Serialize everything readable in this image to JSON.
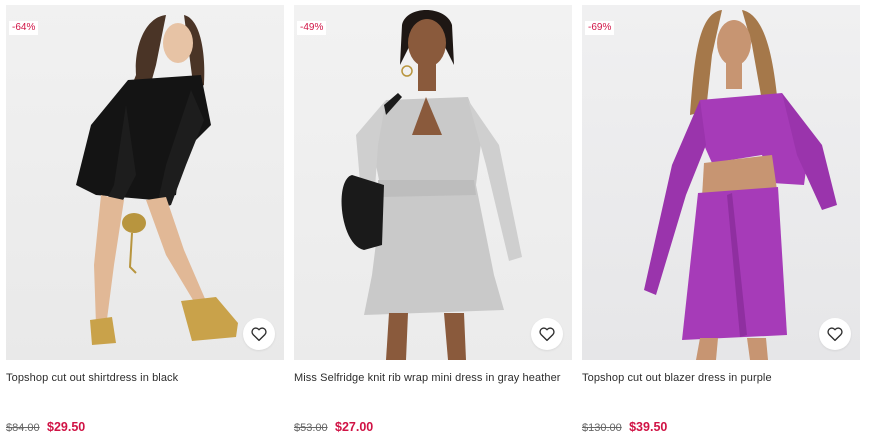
{
  "products": [
    {
      "discount": "-64%",
      "title": "Topshop cut out shirtdress in black",
      "old_price": "$84.00",
      "price": "$29.50",
      "image": "model-black-shirtdress",
      "garment_color": "#141414"
    },
    {
      "discount": "-49%",
      "title": "Miss Selfridge knit rib wrap mini dress in gray heather",
      "old_price": "$53.00",
      "price": "$27.00",
      "image": "model-gray-knit-dress",
      "garment_color": "#c9c9c9"
    },
    {
      "discount": "-69%",
      "title": "Topshop cut out blazer dress in purple",
      "old_price": "$130.00",
      "price": "$39.50",
      "image": "model-purple-blazer-dress",
      "garment_color": "#a63bb8"
    }
  ],
  "icons": {
    "favorite": "heart-outline-icon"
  },
  "colors": {
    "sale": "#d01345",
    "text": "#2d2d2d"
  }
}
